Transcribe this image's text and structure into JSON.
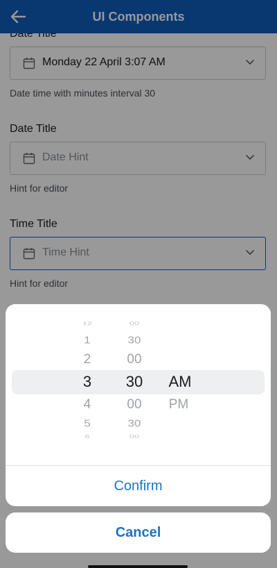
{
  "header": {
    "title": "UI Components",
    "back_icon": "arrow-left-icon"
  },
  "fields": [
    {
      "label": "Date Title",
      "value": "Monday 22 April 3:07 AM",
      "is_hint": false,
      "helper": "Date time with minutes interval 30"
    },
    {
      "label": "Date Title",
      "value": "Date Hint",
      "is_hint": true,
      "helper": "Hint for editor"
    },
    {
      "label": "Time Title",
      "value": "Time Hint",
      "is_hint": true,
      "helper": "Hint for editor"
    }
  ],
  "picker": {
    "hours": [
      "12",
      "1",
      "2",
      "3",
      "4",
      "5",
      "6"
    ],
    "minutes": [
      "00",
      "30",
      "00",
      "30",
      "00",
      "30",
      "00"
    ],
    "periods": [
      "AM",
      "PM"
    ],
    "selected": {
      "hour": "3",
      "minute": "30",
      "period": "AM"
    },
    "confirm_label": "Confirm"
  },
  "cancel_label": "Cancel",
  "colors": {
    "header_bg": "#0f5cbb",
    "accent": "#1a73c8"
  }
}
